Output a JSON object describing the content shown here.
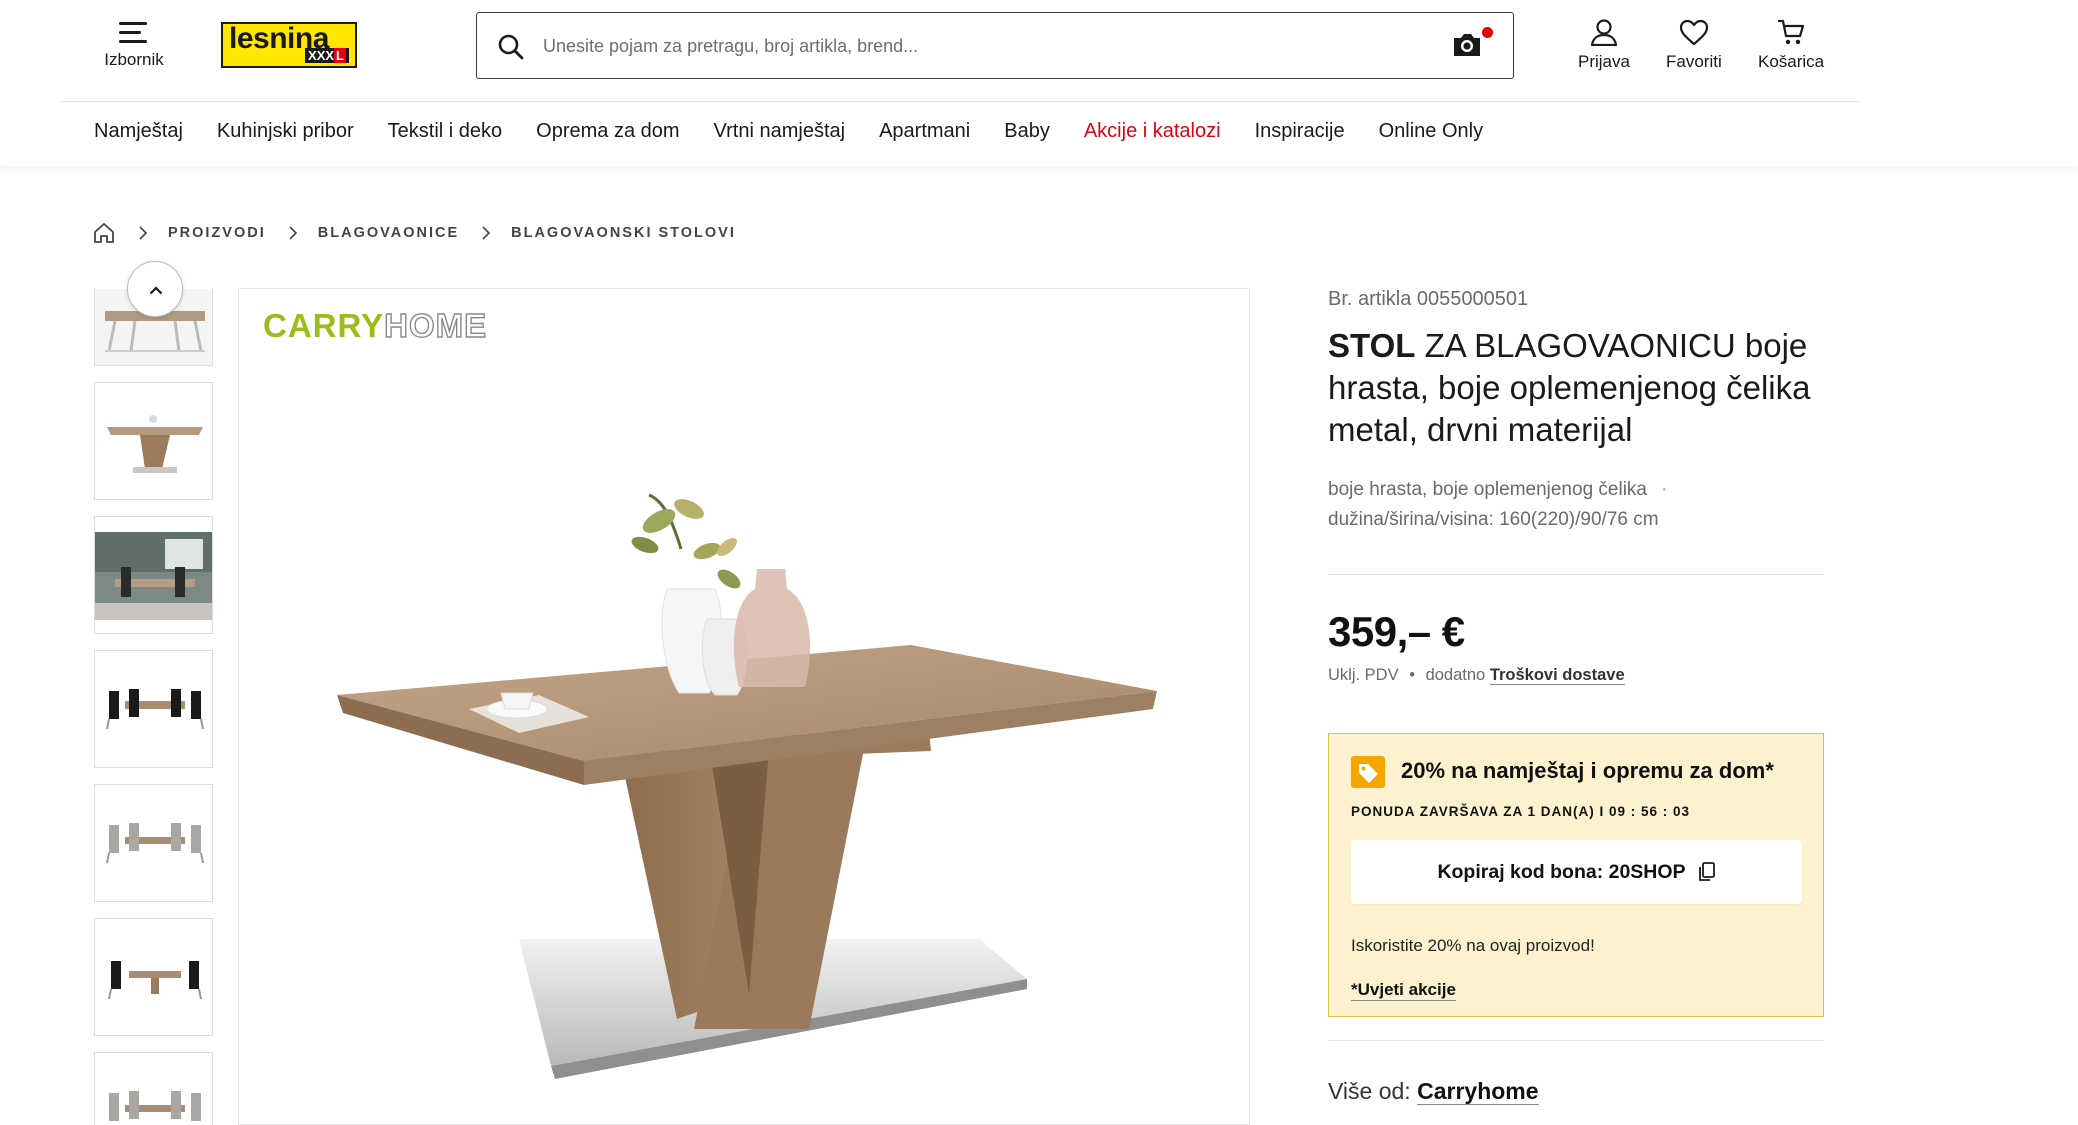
{
  "header": {
    "menu_label": "Izbornik",
    "logo": {
      "word": "lesnina",
      "badge": "XXXL"
    },
    "search_placeholder": "Unesite pojam za pretragu, broj artikla, brend...",
    "actions": [
      {
        "label": "Prijava",
        "icon": "user-icon"
      },
      {
        "label": "Favoriti",
        "icon": "heart-icon"
      },
      {
        "label": "Košarica",
        "icon": "cart-icon"
      }
    ]
  },
  "nav": [
    {
      "label": "Namještaj"
    },
    {
      "label": "Kuhinjski pribor"
    },
    {
      "label": "Tekstil i deko"
    },
    {
      "label": "Oprema za dom"
    },
    {
      "label": "Vrtni namještaj"
    },
    {
      "label": "Apartmani"
    },
    {
      "label": "Baby"
    },
    {
      "label": "Akcije i katalozi",
      "highlight": true
    },
    {
      "label": "Inspiracije"
    },
    {
      "label": "Online Only"
    }
  ],
  "breadcrumb": [
    "PROIZVODI",
    "BLAGOVAONICE",
    "BLAGOVAONSKI STOLOVI"
  ],
  "gallery": {
    "brand_logo_left": "CARRY",
    "brand_logo_right": "HOME",
    "thumbnail_count": 7
  },
  "product": {
    "article_no": "Br. artikla 0055000501",
    "title_bold": "STOL",
    "title_rest": " ZA BLAGOVAONICU boje hrasta, boje oplemenjenog čelika metal, drvni materijal",
    "attr_color": "boje hrasta, boje oplemenjenog čelika",
    "attr_dims": "dužina/širina/visina: 160(220)/90/76 cm",
    "price": "359,– €",
    "vat_note": "Uklj. PDV",
    "shipping_prefix": "dodatno",
    "shipping_link": "Troškovi dostave"
  },
  "promo": {
    "title": "20% na namještaj i opremu za dom*",
    "ends_label": "PONUDA ZAVRŠAVA ZA 1 DAN(A) I",
    "countdown": "09 : 56 : 03",
    "code_button": "Kopiraj kod bona: 20SHOP",
    "note": "Iskoristite 20% na ovaj proizvod!",
    "terms": "*Uvjeti akcije"
  },
  "more_from": {
    "prefix": "Više od:",
    "brand": "Carryhome"
  },
  "colors": {
    "accent_red": "#e3000f",
    "logo_yellow": "#ffe600",
    "promo_bg": "#fdf2d0",
    "promo_border": "#e2c04d",
    "brand_green": "#9bbd1c"
  }
}
